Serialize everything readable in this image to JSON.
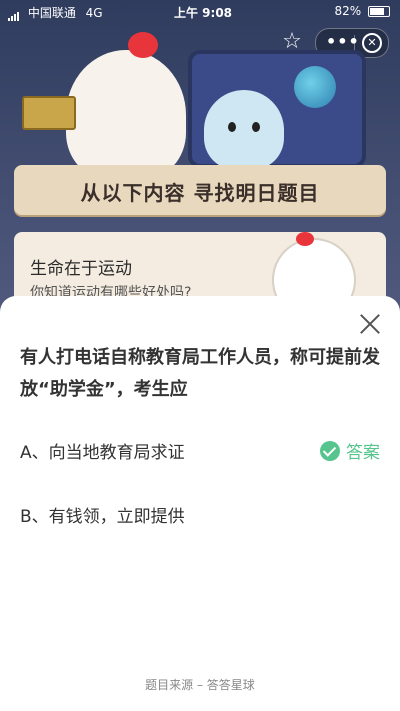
{
  "status": {
    "carrier": "中国联通",
    "network": "4G",
    "time": "上午 9:08",
    "battery": "82%"
  },
  "banner": {
    "title": "从以下内容 寻找明日题目"
  },
  "topic": {
    "title": "生命在于运动",
    "subtitle": "你知道运动有哪些好处吗?"
  },
  "question": {
    "text": "有人打电话自称教育局工作人员，称可提前发放“助学金”，考生应",
    "options": [
      {
        "label": "A、向当地教育局求证"
      },
      {
        "label": "B、有钱领，立即提供"
      }
    ],
    "answer_label": "答案"
  },
  "footer": {
    "source": "题目来源 – 答答星球"
  },
  "colors": {
    "accent": "#55c48d"
  }
}
